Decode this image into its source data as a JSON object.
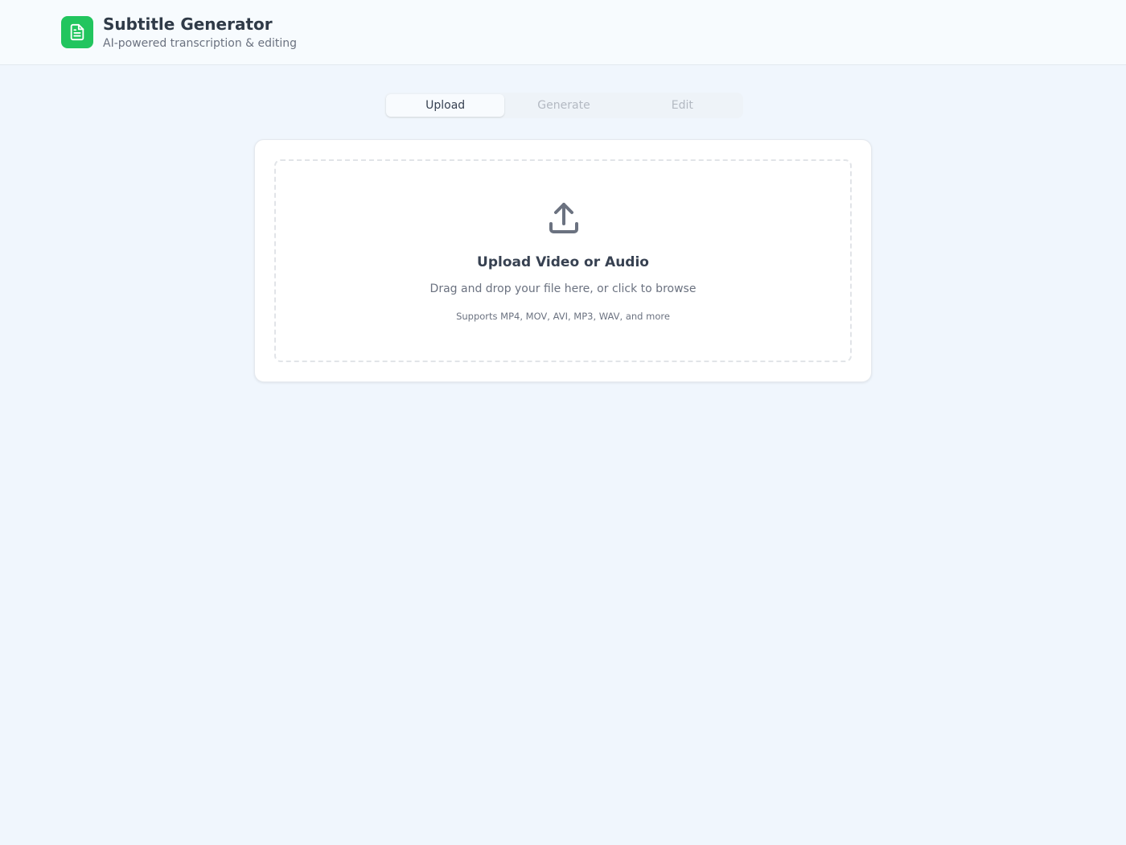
{
  "header": {
    "title": "Subtitle Generator",
    "subtitle": "AI-powered transcription & editing",
    "logo_icon": "document-icon",
    "logo_color": "#22c55e"
  },
  "tabs": [
    {
      "label": "Upload",
      "active": true
    },
    {
      "label": "Generate",
      "active": false
    },
    {
      "label": "Edit",
      "active": false
    }
  ],
  "upload": {
    "icon": "upload-icon",
    "title": "Upload Video or Audio",
    "description": "Drag and drop your file here, or click to browse",
    "formats": "Supports MP4, MOV, AVI, MP3, WAV, and more"
  }
}
